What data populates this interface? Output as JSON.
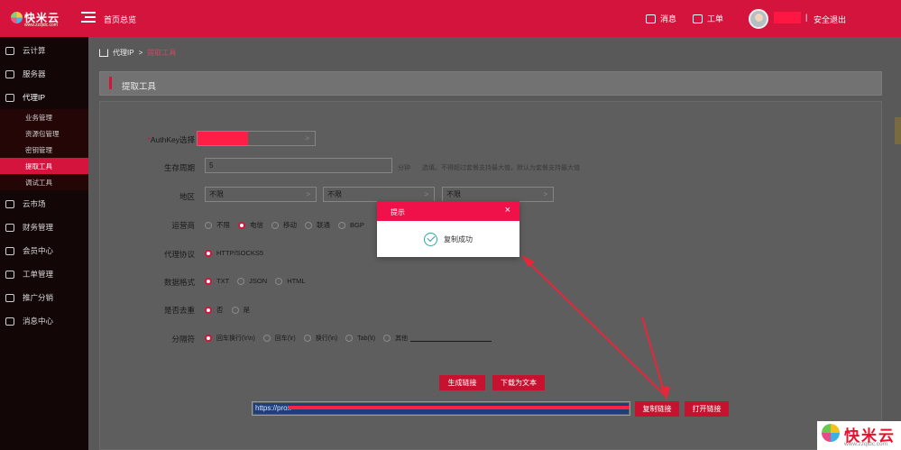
{
  "topbar": {
    "logo_text": "快米云",
    "logo_site": "www.zzqidc.com",
    "home_label": "首页总览",
    "messages_label": "消息",
    "tickets_label": "工单",
    "separator": "|",
    "logout_label": "安全退出"
  },
  "sidebar": {
    "items": [
      {
        "label": "云计算"
      },
      {
        "label": "服务器"
      },
      {
        "label": "代理IP"
      },
      {
        "label": "云市场"
      },
      {
        "label": "财务管理"
      },
      {
        "label": "会员中心"
      },
      {
        "label": "工单管理"
      },
      {
        "label": "推广分销"
      },
      {
        "label": "消息中心"
      }
    ],
    "sub_items": [
      {
        "label": "业务管理"
      },
      {
        "label": "资源包管理"
      },
      {
        "label": "密钥管理"
      },
      {
        "label": "提取工具"
      },
      {
        "label": "调试工具"
      }
    ]
  },
  "breadcrumb": {
    "root": "代理IP",
    "sep": ">",
    "current": "提取工具"
  },
  "section": {
    "title": "提取工具"
  },
  "form": {
    "authkey": {
      "required_mark": "*",
      "label": "AuthKey选择",
      "arrow": ">"
    },
    "lifetime": {
      "label": "生存周期",
      "value": "5",
      "unit": "分钟",
      "hint": "选填。不得超过套餐支持最大值，默认为套餐支持最大值"
    },
    "region": {
      "label": "地区",
      "selects": [
        "不限",
        "不限",
        "不限"
      ],
      "arrow": ">"
    },
    "isp": {
      "label": "运营商",
      "options": [
        "不限",
        "电信",
        "移动",
        "联通",
        "BGP"
      ],
      "selected": "电信"
    },
    "protocol": {
      "label": "代理协议",
      "options": [
        "HTTP/SOCKS5"
      ],
      "selected": "HTTP/SOCKS5"
    },
    "format": {
      "label": "数据格式",
      "options": [
        "TXT",
        "JSON",
        "HTML"
      ],
      "selected": "TXT"
    },
    "dedupe": {
      "label": "是否去重",
      "options": [
        "否",
        "是"
      ],
      "selected": "否"
    },
    "delimiter": {
      "label": "分隔符",
      "options": [
        "回车换行(\\r\\n)",
        "回车(\\r)",
        "换行(\\n)",
        "Tab(\\t)",
        "其他"
      ],
      "selected": "回车换行(\\r\\n)"
    }
  },
  "buttons": {
    "generate": "生成链接",
    "download": "下载为文本",
    "copy": "复制链接",
    "open": "打开链接"
  },
  "url": {
    "visible_prefix": "https://prox"
  },
  "modal": {
    "title": "提示",
    "close": "×",
    "message": "复制成功"
  },
  "watermark": {
    "text": "快米云",
    "domain": "www.zzqidc.com"
  },
  "colors": {
    "brand": "#d4143c",
    "modal_head": "#f0104a",
    "button": "#c7122f",
    "selection": "#1e3f7a"
  }
}
